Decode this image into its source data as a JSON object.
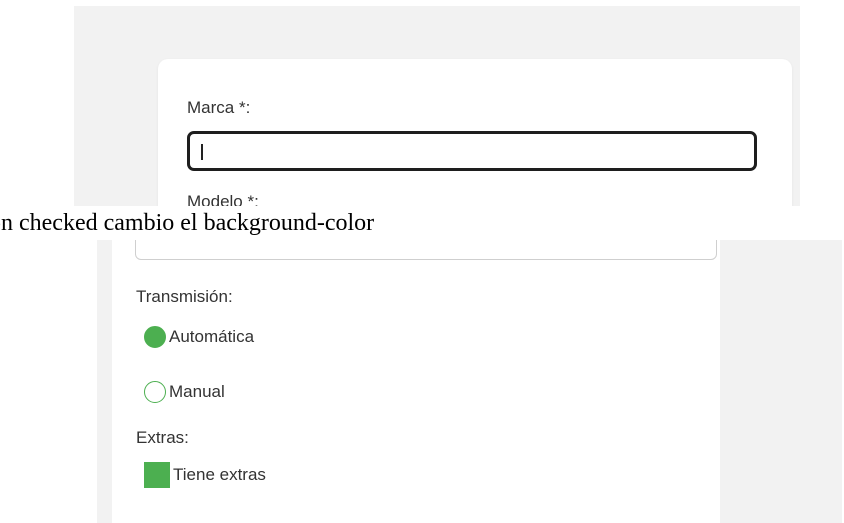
{
  "form": {
    "marca_label": "Marca *:",
    "marca_value": "",
    "modelo_label": "Modelo *:",
    "transmision_label": "Transmisión:",
    "transmision_options": [
      {
        "label": "Automática",
        "checked": true
      },
      {
        "label": "Manual",
        "checked": false
      }
    ],
    "extras_label": "Extras:",
    "extras_checkbox": {
      "label": "Tiene extras",
      "checked": true
    }
  },
  "caption": "on checked cambio el background-color",
  "colors": {
    "accent": "#4caf50",
    "screenshot_background": "#f2f2f2",
    "card": "#ffffff",
    "focus_border": "#1e1e1e"
  }
}
